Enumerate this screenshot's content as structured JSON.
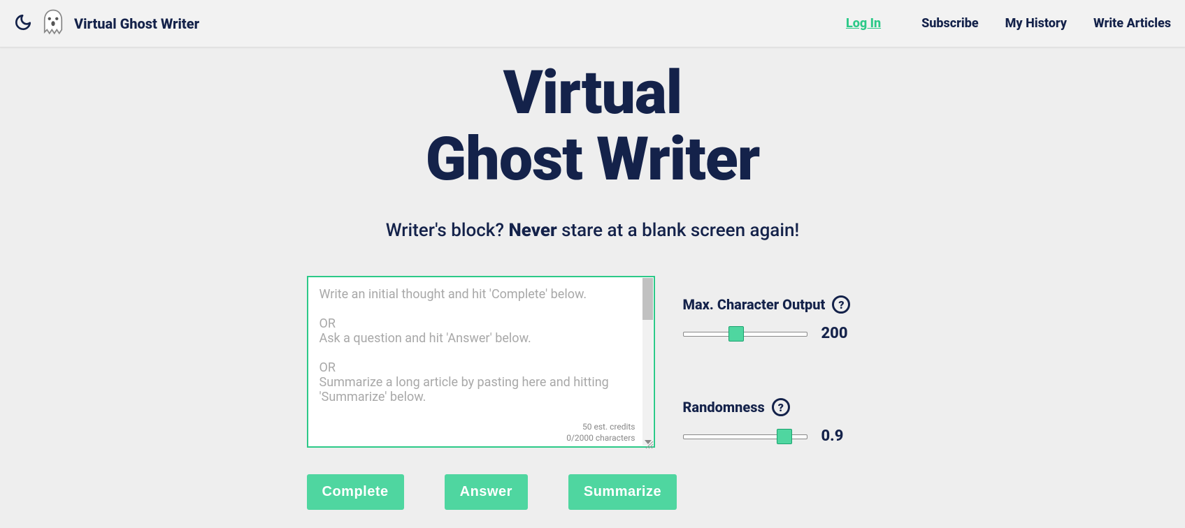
{
  "header": {
    "app_title": "Virtual Ghost Writer",
    "nav": {
      "login": "Log In",
      "subscribe": "Subscribe",
      "history": "My History",
      "write": "Write Articles"
    }
  },
  "hero": {
    "title": "Virtual\nGhost Writer",
    "tagline_pre": "Writer's block? ",
    "tagline_bold": "Never",
    "tagline_post": " stare at a blank screen again!"
  },
  "textarea": {
    "placeholder": "Write an initial thought and hit 'Complete' below.\n\nOR\nAsk a question and hit 'Answer' below.\n\nOR\nSummarize a long article by pasting here and hitting 'Summarize' below.",
    "value": "",
    "credits_line": "50 est. credits",
    "chars_line": "0/2000 characters"
  },
  "controls": {
    "max_output": {
      "label": "Max. Character Output",
      "value": "200",
      "position_pct": 42
    },
    "randomness": {
      "label": "Randomness",
      "value": "0.9",
      "position_pct": 86
    }
  },
  "buttons": {
    "complete": "Complete",
    "answer": "Answer",
    "summarize": "Summarize"
  }
}
